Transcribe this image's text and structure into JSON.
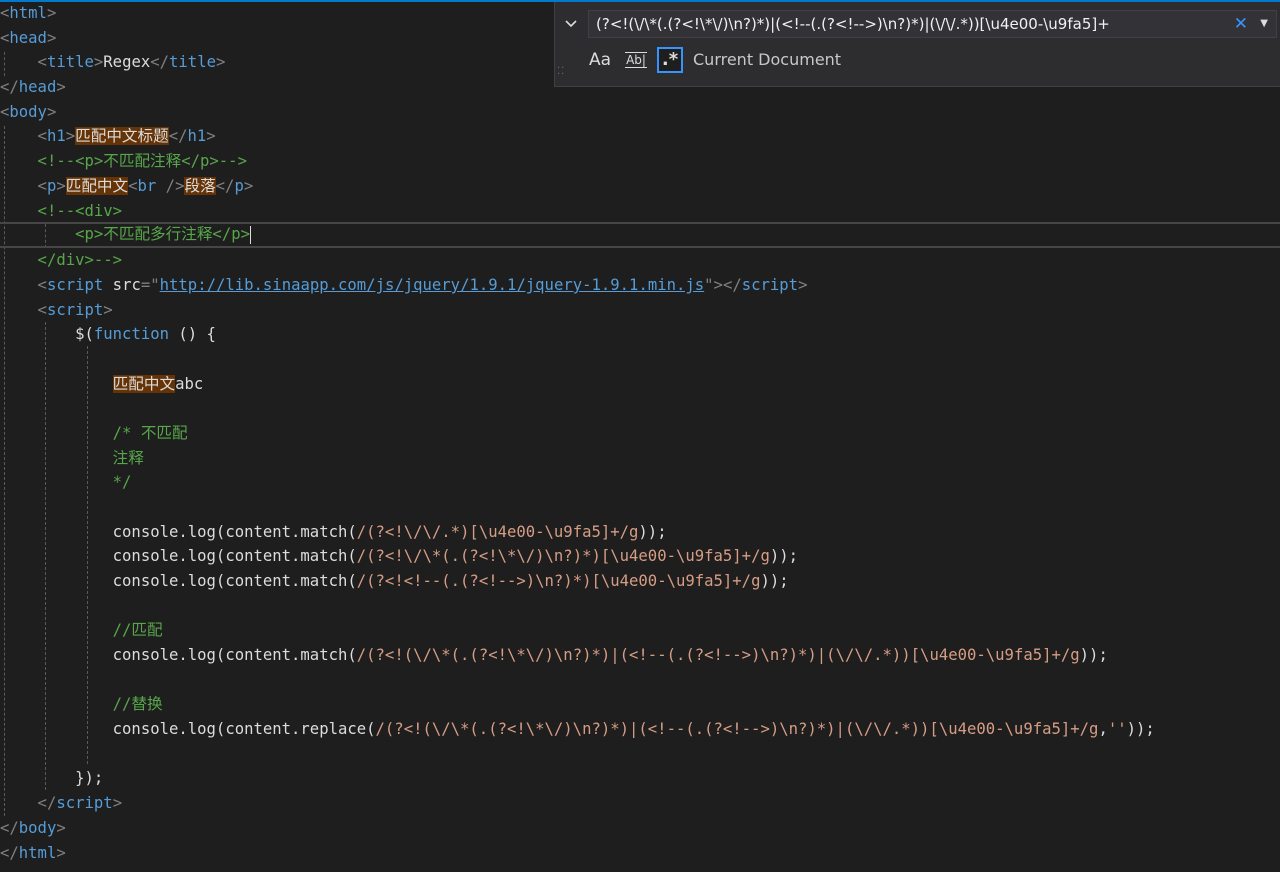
{
  "colors": {
    "background": "#1e1e1e",
    "tag": "#569cd6",
    "comment": "#57a64a",
    "string": "#d69d85",
    "match_highlight": "#653306",
    "find_accent": "#3794ff"
  },
  "find_widget": {
    "query": "(?<!(\\/\\*(.(?<!\\*\\/)\\n?)*)|(<!--(.(?<!-->)\\n?)*)|(\\/\\/.*))[\\u4e00-\\u9fa5]+",
    "scope": "Current Document",
    "match_case_label": "Aa",
    "whole_word_label": "Ab|",
    "regex_label": ".*",
    "toggle_icon": "chevron-down-icon",
    "close_icon": "close-icon",
    "dropdown_icon": "caret-down-icon",
    "regex_enabled": true
  },
  "code": {
    "l1": {
      "a": "<",
      "b": "html",
      "c": ">"
    },
    "l2": {
      "a": "<",
      "b": "head",
      "c": ">"
    },
    "l3": {
      "a": "    <",
      "b": "title",
      "c": ">",
      "d": "Regex",
      "e": "</",
      "f": "title",
      "g": ">"
    },
    "l4": {
      "a": "</",
      "b": "head",
      "c": ">"
    },
    "l5": {
      "a": "<",
      "b": "body",
      "c": ">"
    },
    "l6": {
      "a": "    <",
      "b": "h1",
      "c": ">",
      "d": "匹配中文标题",
      "e": "</",
      "f": "h1",
      "g": ">"
    },
    "l7": {
      "a": "    <!--<p>不匹配注释</p>-->"
    },
    "l8": {
      "a": "    <",
      "b": "p",
      "c": ">",
      "d": "匹配中文",
      "e": "<",
      "f": "br",
      "g": " />",
      "h": "段落",
      "i": "</",
      "j": "p",
      "k": ">"
    },
    "l9": {
      "a": "    <!--<div>"
    },
    "l10": {
      "a": "        <p>不匹配多行注释</p>"
    },
    "l11": {
      "a": "    </div>-->"
    },
    "l12": {
      "a": "    <",
      "b": "script",
      "c": " src",
      "d": "=\"",
      "e": "http://lib.sinaapp.com/js/jquery/1.9.1/jquery-1.9.1.min.js",
      "f": "\">",
      "g": "</",
      "h": "script",
      "i": ">"
    },
    "l13": {
      "a": "    <",
      "b": "script",
      "c": ">"
    },
    "l14": {
      "a": "        $(",
      "b": "function",
      "c": " () {"
    },
    "l16": {
      "a": "            ",
      "b": "匹配中文",
      "c": "abc"
    },
    "l18": {
      "a": "            /* 不匹配"
    },
    "l19": {
      "a": "            注释"
    },
    "l20": {
      "a": "            */"
    },
    "l22": {
      "a": "            console.log(content.match(",
      "b": "/(?<!\\/\\/.*)[\\u4e00-\\u9fa5]+/g",
      "c": "));"
    },
    "l23": {
      "a": "            console.log(content.match(",
      "b": "/(?<!\\/\\*(.(?<!\\*\\/)\\n?)*)[\\u4e00-\\u9fa5]+/g",
      "c": "));"
    },
    "l24": {
      "a": "            console.log(content.match(",
      "b": "/(?<!<!--(.(?<!-->)\\n?)*)[\\u4e00-\\u9fa5]+/g",
      "c": "));"
    },
    "l26": {
      "a": "            //匹配"
    },
    "l27": {
      "a": "            console.log(content.match(",
      "b": "/(?<!(\\/\\*(.(?<!\\*\\/)\\n?)*)|(<!--(.(?<!-->)\\n?)*)|(\\/\\/.*))[\\u4e00-\\u9fa5]+/g",
      "c": "));"
    },
    "l29": {
      "a": "            //替换"
    },
    "l30": {
      "a": "            console.log(content.replace(",
      "b": "/(?<!(\\/\\*(.(?<!\\*\\/)\\n?)*)|(<!--(.(?<!-->)\\n?)*)|(\\/\\/.*))[\\u4e00-\\u9fa5]+/g",
      "c": ",",
      "d": "''",
      "e": "));"
    },
    "l32": {
      "a": "        });"
    },
    "l33": {
      "a": "    </",
      "b": "script",
      "c": ">"
    },
    "l34": {
      "a": "</",
      "b": "body",
      "c": ">"
    },
    "l35": {
      "a": "</",
      "b": "html",
      "c": ">"
    }
  }
}
